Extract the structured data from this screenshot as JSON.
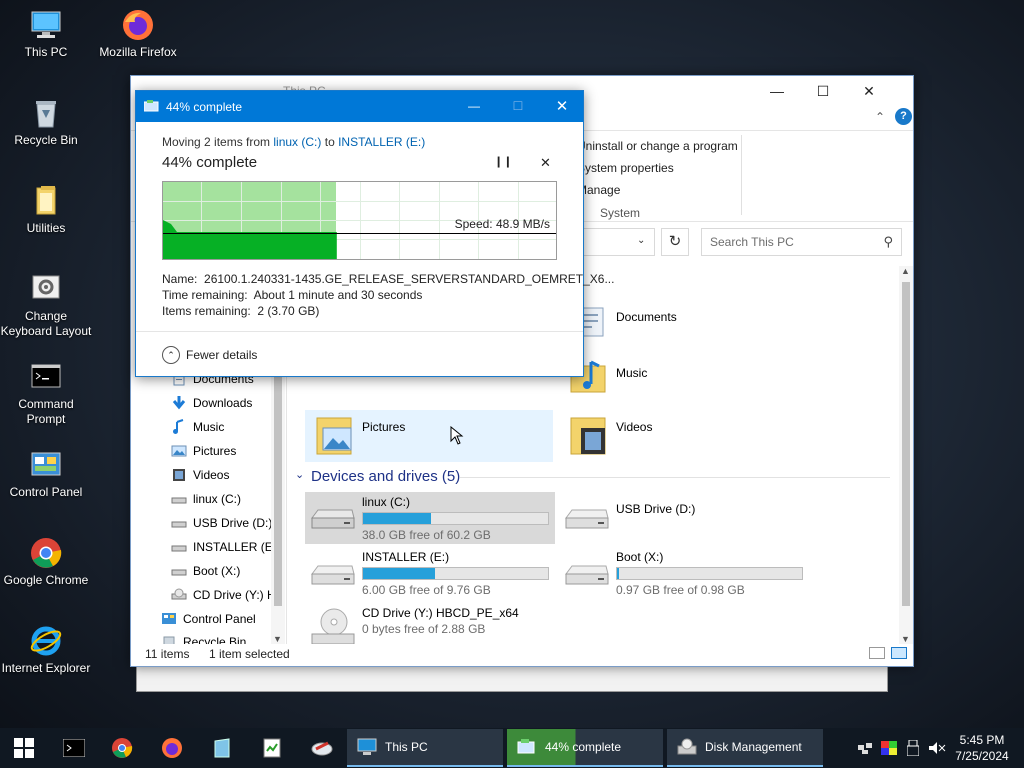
{
  "desktop_icons": [
    {
      "label": "This PC"
    },
    {
      "label": "Mozilla Firefox"
    },
    {
      "label": "Recycle Bin"
    },
    {
      "label": "Utilities"
    },
    {
      "label": "Change Keyboard Layout"
    },
    {
      "label": "Command Prompt"
    },
    {
      "label": "Control Panel"
    },
    {
      "label": "Google Chrome"
    },
    {
      "label": "Internet Explorer"
    }
  ],
  "explorer": {
    "title": "This PC",
    "ribbon": {
      "items": [
        "Uninstall or change a program",
        "System properties",
        "Manage"
      ],
      "group_label": "System"
    },
    "search_placeholder": "Search This PC",
    "nav_items": [
      "Documents",
      "Downloads",
      "Music",
      "Pictures",
      "Videos",
      "linux (C:)",
      "USB Drive (D:)",
      "INSTALLER (E:)",
      "Boot (X:)",
      "CD Drive (Y:) H",
      "Control Panel",
      "Recycle Bin"
    ],
    "folders": [
      "Documents",
      "Music",
      "Pictures",
      "Videos"
    ],
    "devices_header": "Devices and drives (5)",
    "drives": [
      {
        "name": "linux (C:)",
        "free": "38.0 GB free of 60.2 GB",
        "used_fraction": 0.37
      },
      {
        "name": "USB Drive (D:)",
        "free": "",
        "used_fraction": null
      },
      {
        "name": "INSTALLER (E:)",
        "free": "6.00 GB free of 9.76 GB",
        "used_fraction": 0.39
      },
      {
        "name": "Boot (X:)",
        "free": "0.97 GB free of 0.98 GB",
        "used_fraction": 0.01
      },
      {
        "name": "CD Drive (Y:) HBCD_PE_x64",
        "free": "0 bytes free of 2.88 GB",
        "used_fraction": null
      }
    ],
    "status": {
      "items": "11 items",
      "selected": "1 item selected"
    }
  },
  "copy_dialog": {
    "title": "44% complete",
    "moving_prefix": "Moving 2 items from",
    "from": "linux (C:)",
    "to_word": "to",
    "to": "INSTALLER (E:)",
    "heading": "44% complete",
    "progress_percent": 44,
    "speed": "Speed: 48.9 MB/s",
    "name_label": "Name:",
    "name_value": "26100.1.240331-1435.GE_RELEASE_SERVERSTANDARD_OEMRET_X6...",
    "time_label": "Time remaining:",
    "time_value": "About 1 minute and 30 seconds",
    "items_label": "Items remaining:",
    "items_value": "2 (3.70 GB)",
    "fewer_details": "Fewer details"
  },
  "taskbar": {
    "tasks": [
      "This PC",
      "44% complete",
      "Disk Management"
    ],
    "time": "5:45 PM",
    "date": "7/25/2024"
  },
  "colors": {
    "accent": "#0078d7",
    "progress_green": "#06b025",
    "drive_bar": "#26a0da"
  }
}
